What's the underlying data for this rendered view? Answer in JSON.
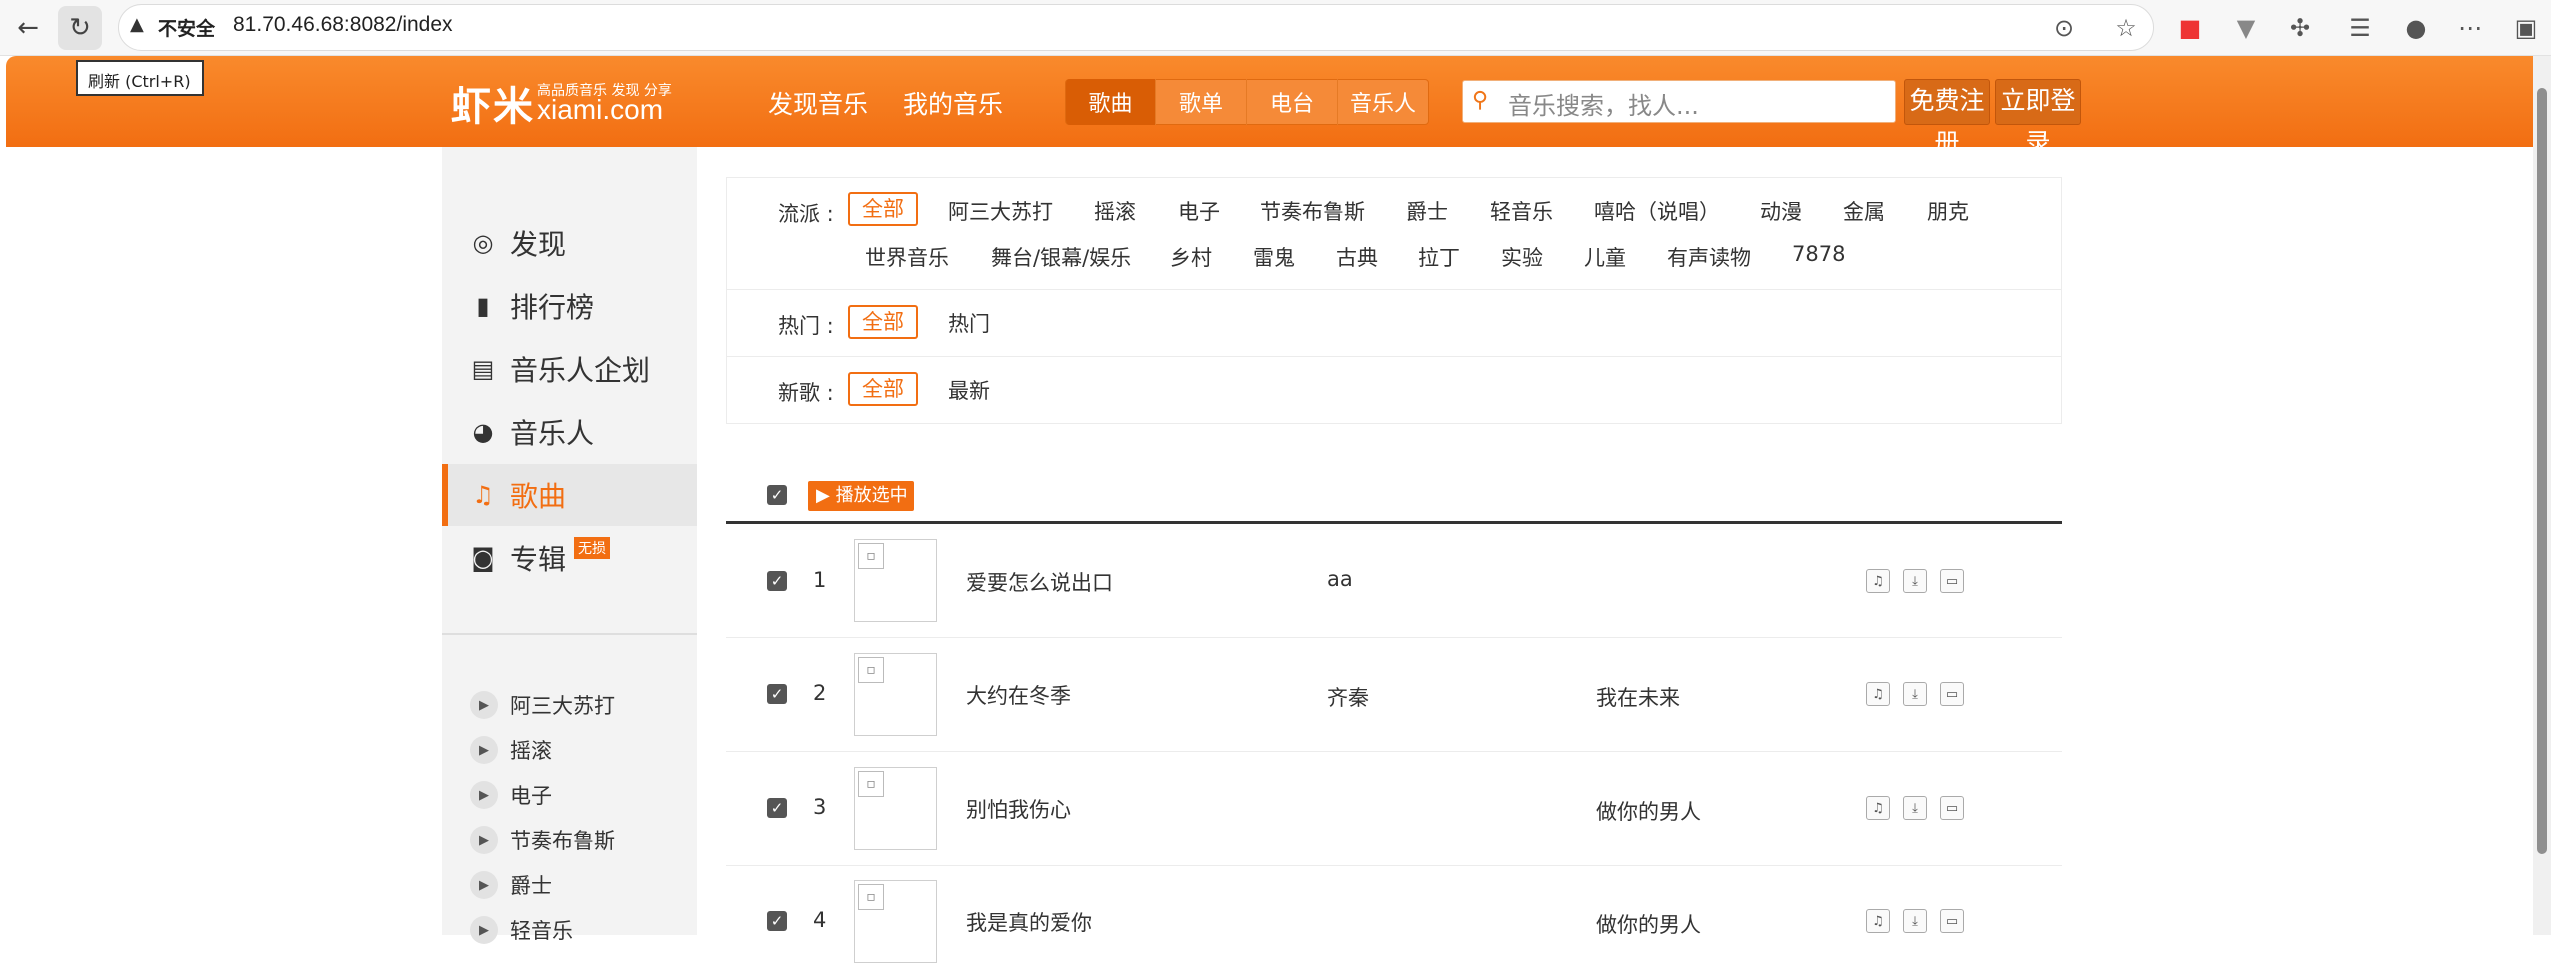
{
  "browser": {
    "security_label": "不安全",
    "url": "81.70.46.68:8082/index",
    "tooltip": "刷新 (Ctrl+R)"
  },
  "header": {
    "logo_cn": "虾米",
    "logo_tagline": "高品质音乐 发现 分享",
    "logo_en": "xiami.com",
    "nav": [
      "发现音乐",
      "我的音乐"
    ],
    "tabs": [
      "歌曲",
      "歌单",
      "电台",
      "音乐人"
    ],
    "active_tab": "歌曲",
    "search_placeholder": "音乐搜索，找人...",
    "register_label": "免费注册",
    "login_label": "立即登录",
    "accent_color": "#f26e12"
  },
  "sidebar": {
    "items": [
      {
        "label": "发现",
        "icon": "compass-icon"
      },
      {
        "label": "排行榜",
        "icon": "bar-chart-icon"
      },
      {
        "label": "音乐人企划",
        "icon": "document-icon"
      },
      {
        "label": "音乐人",
        "icon": "disc-icon"
      },
      {
        "label": "歌曲",
        "icon": "music-note-icon",
        "active": true
      },
      {
        "label": "专辑",
        "icon": "album-icon",
        "badge": "无损"
      }
    ],
    "genres": [
      "阿三大苏打",
      "摇滚",
      "电子",
      "节奏布鲁斯",
      "爵士",
      "轻音乐"
    ]
  },
  "filters": {
    "genre": {
      "label": "流派 :",
      "selected": "全部",
      "row1": [
        "阿三大苏打",
        "摇滚",
        "电子",
        "节奏布鲁斯",
        "爵士",
        "轻音乐",
        "嘻哈（说唱）",
        "动漫",
        "金属",
        "朋克"
      ],
      "row2": [
        "世界音乐",
        "舞台/银幕/娱乐",
        "乡村",
        "雷鬼",
        "古典",
        "拉丁",
        "实验",
        "儿童",
        "有声读物",
        "7878"
      ]
    },
    "hot": {
      "label": "热门 :",
      "selected": "全部",
      "options": [
        "热门"
      ]
    },
    "new": {
      "label": "新歌 :",
      "selected": "全部",
      "options": [
        "最新"
      ]
    }
  },
  "list": {
    "play_selected_label": "播放选中",
    "songs": [
      {
        "index": "1",
        "title": "爱要怎么说出口",
        "artist": "aa",
        "album": ""
      },
      {
        "index": "2",
        "title": "大约在冬季",
        "artist": "齐秦",
        "album": "我在未来"
      },
      {
        "index": "3",
        "title": "别怕我伤心",
        "artist": "",
        "album": "做你的男人"
      },
      {
        "index": "4",
        "title": "我是真的爱你",
        "artist": "",
        "album": "做你的男人"
      }
    ]
  }
}
